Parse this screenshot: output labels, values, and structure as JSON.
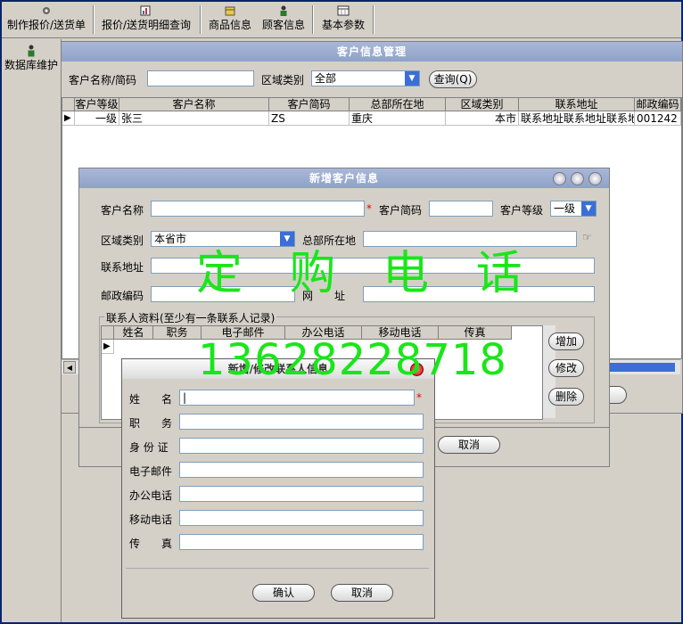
{
  "toolbar": {
    "items": [
      "制作报价/送货单",
      "报价/送货明细查询",
      "商品信息",
      "顾客信息",
      "基本参数"
    ]
  },
  "left_panel": {
    "db_label": "数据库维护"
  },
  "main_window": {
    "title": "客户信息管理",
    "search_label": "客户名称/简码",
    "search_value": "",
    "region_label": "区域类别",
    "region_value": "全部",
    "query_button": "查询(Q)",
    "columns": [
      "客户等级",
      "客户名称",
      "客户简码",
      "总部所在地",
      "区域类别",
      "联系地址",
      "邮政编码"
    ],
    "rows": [
      [
        "一级",
        "张三",
        "ZS",
        "重庆",
        "本市",
        "联系地址联系地址联系地",
        "001242"
      ]
    ]
  },
  "add_customer_dialog": {
    "title": "新增客户信息",
    "customer_name_label": "客户名称",
    "customer_code_label": "客户简码",
    "customer_level_label": "客户等级",
    "customer_level_value": "一级",
    "region_label": "区域类别",
    "region_value": "本省市",
    "hq_label": "总部所在地",
    "address_label": "联系地址",
    "postcode_label": "邮政编码",
    "website_label": "网　　址",
    "contacts_group_label": "联系人资料(至少有一条联系人记录)",
    "contact_columns": [
      "姓名",
      "职务",
      "电子邮件",
      "办公电话",
      "移动电话",
      "传真"
    ],
    "add_button": "增加",
    "edit_button": "修改",
    "delete_button": "删除",
    "cancel_button": "取消",
    "required_mark": "*"
  },
  "contact_dialog": {
    "title": "新增/修改联系人信息",
    "fields": [
      "姓　　名",
      "职　　务",
      "身 份 证",
      "电子邮件",
      "办公电话",
      "移动电话",
      "传　　真"
    ],
    "ok_button": "确认",
    "cancel_button": "取消",
    "required_mark": "*"
  },
  "watermark": {
    "text1": "定 购 电 话",
    "text2": "13628228718"
  },
  "colors": {
    "watermark": "#19e619",
    "frame": "#0a246a",
    "titlebar": "#8ea2c8",
    "dropdown": "#3a6fd8"
  }
}
